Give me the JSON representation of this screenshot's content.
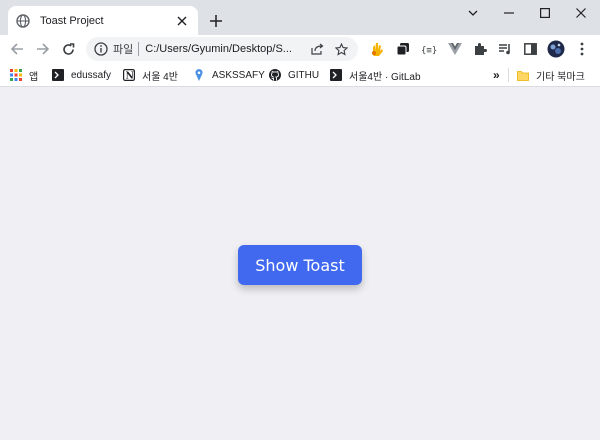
{
  "browser": {
    "tab": {
      "title": "Toast Project"
    },
    "omnibox": {
      "label": "파일",
      "url": "C:/Users/Gyumin/Desktop/S..."
    },
    "bookmarks": {
      "items": [
        {
          "label": "앱",
          "icon": "apps-grid-icon"
        },
        {
          "label": "edussafy",
          "icon": "terminal-icon"
        },
        {
          "label": "서울 4반",
          "icon": "notion-icon"
        },
        {
          "label": "ASKSSAFY",
          "icon": "pin-icon"
        },
        {
          "label": "GITHU",
          "icon": "github-icon"
        },
        {
          "label": "서울4반 · GitLab",
          "icon": "terminal-icon"
        }
      ],
      "overflow": "»",
      "other": {
        "label": "기타 북마크",
        "icon": "folder-icon"
      }
    }
  },
  "page": {
    "button_label": "Show Toast"
  },
  "colors": {
    "accent": "#4169f0",
    "page_bg": "#f0eff3",
    "tabstrip_bg": "#dee1e6"
  }
}
